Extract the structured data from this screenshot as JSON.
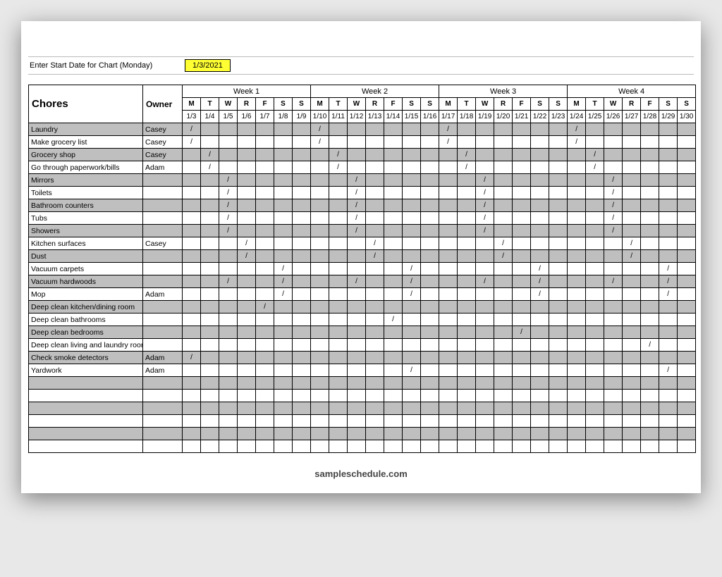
{
  "top": {
    "label": "Enter Start Date for Chart (Monday)",
    "date": "1/3/2021"
  },
  "headers": {
    "chores": "Chores",
    "owner": "Owner",
    "weeks": [
      "Week 1",
      "Week 2",
      "Week 3",
      "Week 4"
    ],
    "days": [
      "M",
      "T",
      "W",
      "R",
      "F",
      "S",
      "S"
    ],
    "dates": [
      "1/3",
      "1/4",
      "1/5",
      "1/6",
      "1/7",
      "1/8",
      "1/9",
      "1/10",
      "1/11",
      "1/12",
      "1/13",
      "1/14",
      "1/15",
      "1/16",
      "1/17",
      "1/18",
      "1/19",
      "1/20",
      "1/21",
      "1/22",
      "1/23",
      "1/24",
      "1/25",
      "1/26",
      "1/27",
      "1/28",
      "1/29",
      "1/30"
    ]
  },
  "rows": [
    {
      "chore": "Laundry",
      "owner": "Casey",
      "marks": [
        0,
        7,
        14,
        21
      ],
      "shaded": true
    },
    {
      "chore": "Make grocery list",
      "owner": "Casey",
      "marks": [
        0,
        7,
        14,
        21
      ],
      "shaded": false
    },
    {
      "chore": "Grocery shop",
      "owner": "Casey",
      "marks": [
        1,
        8,
        15,
        22
      ],
      "shaded": true
    },
    {
      "chore": "Go through paperwork/bills",
      "owner": "Adam",
      "marks": [
        1,
        8,
        15,
        22
      ],
      "shaded": false
    },
    {
      "chore": "Mirrors",
      "owner": "",
      "marks": [
        2,
        9,
        16,
        23
      ],
      "shaded": true
    },
    {
      "chore": "Toilets",
      "owner": "",
      "marks": [
        2,
        9,
        16,
        23
      ],
      "shaded": false
    },
    {
      "chore": "Bathroom counters",
      "owner": "",
      "marks": [
        2,
        9,
        16,
        23
      ],
      "shaded": true
    },
    {
      "chore": "Tubs",
      "owner": "",
      "marks": [
        2,
        9,
        16,
        23
      ],
      "shaded": false
    },
    {
      "chore": "Showers",
      "owner": "",
      "marks": [
        2,
        9,
        16,
        23
      ],
      "shaded": true
    },
    {
      "chore": "Kitchen surfaces",
      "owner": "Casey",
      "marks": [
        3,
        10,
        17,
        24
      ],
      "shaded": false
    },
    {
      "chore": "Dust",
      "owner": "",
      "marks": [
        3,
        10,
        17,
        24
      ],
      "shaded": true
    },
    {
      "chore": "Vacuum carpets",
      "owner": "",
      "marks": [
        5,
        12,
        19,
        26
      ],
      "shaded": false
    },
    {
      "chore": "Vacuum hardwoods",
      "owner": "",
      "marks": [
        2,
        5,
        9,
        12,
        16,
        19,
        23,
        26
      ],
      "shaded": true
    },
    {
      "chore": "Mop",
      "owner": "Adam",
      "marks": [
        5,
        12,
        19,
        26
      ],
      "shaded": false
    },
    {
      "chore": "Deep clean kitchen/dining room",
      "owner": "",
      "marks": [
        4
      ],
      "shaded": true
    },
    {
      "chore": "Deep clean bathrooms",
      "owner": "",
      "marks": [
        11
      ],
      "shaded": false
    },
    {
      "chore": "Deep clean bedrooms",
      "owner": "",
      "marks": [
        18
      ],
      "shaded": true
    },
    {
      "chore": "Deep clean living and laundry rooms",
      "owner": "",
      "marks": [
        25
      ],
      "shaded": false
    },
    {
      "chore": "Check smoke detectors",
      "owner": "Adam",
      "marks": [
        0
      ],
      "shaded": true
    },
    {
      "chore": "Yardwork",
      "owner": "Adam",
      "marks": [
        12,
        26
      ],
      "shaded": false
    },
    {
      "chore": "",
      "owner": "",
      "marks": [],
      "shaded": true
    },
    {
      "chore": "",
      "owner": "",
      "marks": [],
      "shaded": false
    },
    {
      "chore": "",
      "owner": "",
      "marks": [],
      "shaded": true
    },
    {
      "chore": "",
      "owner": "",
      "marks": [],
      "shaded": false
    },
    {
      "chore": "",
      "owner": "",
      "marks": [],
      "shaded": true
    },
    {
      "chore": "",
      "owner": "",
      "marks": [],
      "shaded": false
    }
  ],
  "footer": "sampleschedule.com",
  "mark_char": "/"
}
